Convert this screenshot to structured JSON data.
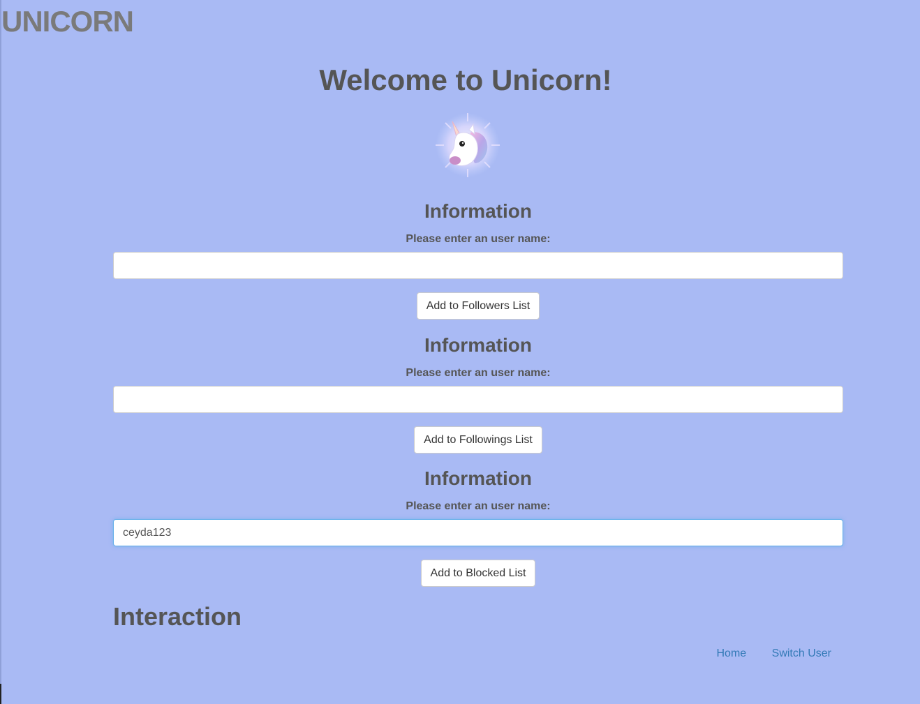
{
  "brand": "UNICORN",
  "welcome_title": "Welcome to Unicorn!",
  "logo": {
    "icon": "unicorn-head-icon"
  },
  "forms": [
    {
      "heading": "Information",
      "label": "Please enter an user name:",
      "value": "",
      "button_label": "Add to Followers List"
    },
    {
      "heading": "Information",
      "label": "Please enter an user name:",
      "value": "",
      "button_label": "Add to Followings List"
    },
    {
      "heading": "Information",
      "label": "Please enter an user name:",
      "value": "ceyda123",
      "button_label": "Add to Blocked List"
    }
  ],
  "interaction_heading": "Interaction",
  "nav": {
    "home": "Home",
    "switch_user": "Switch User"
  },
  "colors": {
    "background": "#a9baf4",
    "text": "#555555",
    "link": "#337ab7",
    "focus": "#66afe9"
  }
}
